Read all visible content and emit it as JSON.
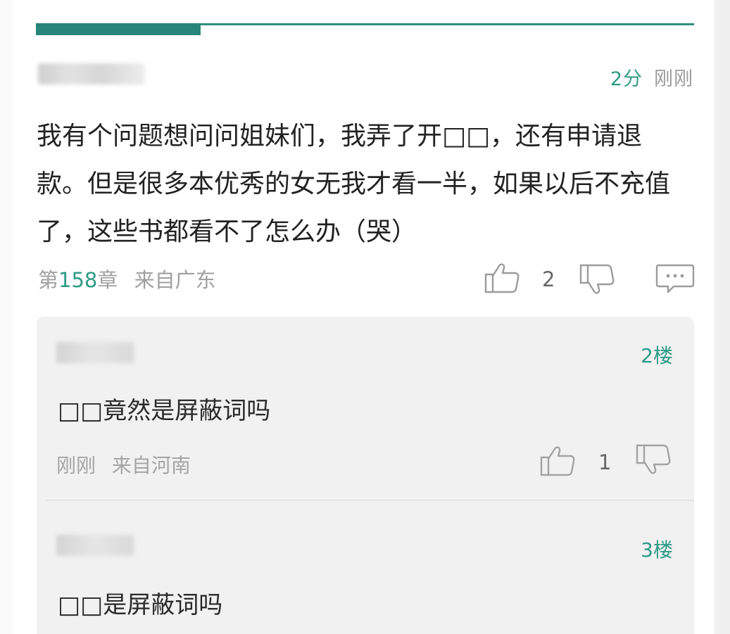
{
  "header": {
    "score": "2分",
    "time": "刚刚"
  },
  "comment": {
    "text": "我有个问题想问问姐妹们，我弄了开□□，还有申请退款。但是很多本优秀的女无我才看一半，如果以后不充值了，这些书都看不了怎么办（哭）",
    "chapter_prefix": "第",
    "chapter_number": "158",
    "chapter_suffix": "章",
    "location": "来自广东",
    "like_count": "2"
  },
  "replies": [
    {
      "floor": "2楼",
      "text": "□□竟然是屏蔽词吗",
      "time": "刚刚",
      "location": "来自河南",
      "like_count": "1"
    },
    {
      "floor": "3楼",
      "text": "□□是屏蔽词吗"
    }
  ],
  "icons": {
    "like": "thumbs-up-icon",
    "dislike": "thumbs-down-icon",
    "reply": "comment-bubble-icon"
  },
  "colors": {
    "accent": "#2e9b85",
    "progress": "#27857a",
    "muted": "#a0a0a0",
    "text": "#222222"
  }
}
